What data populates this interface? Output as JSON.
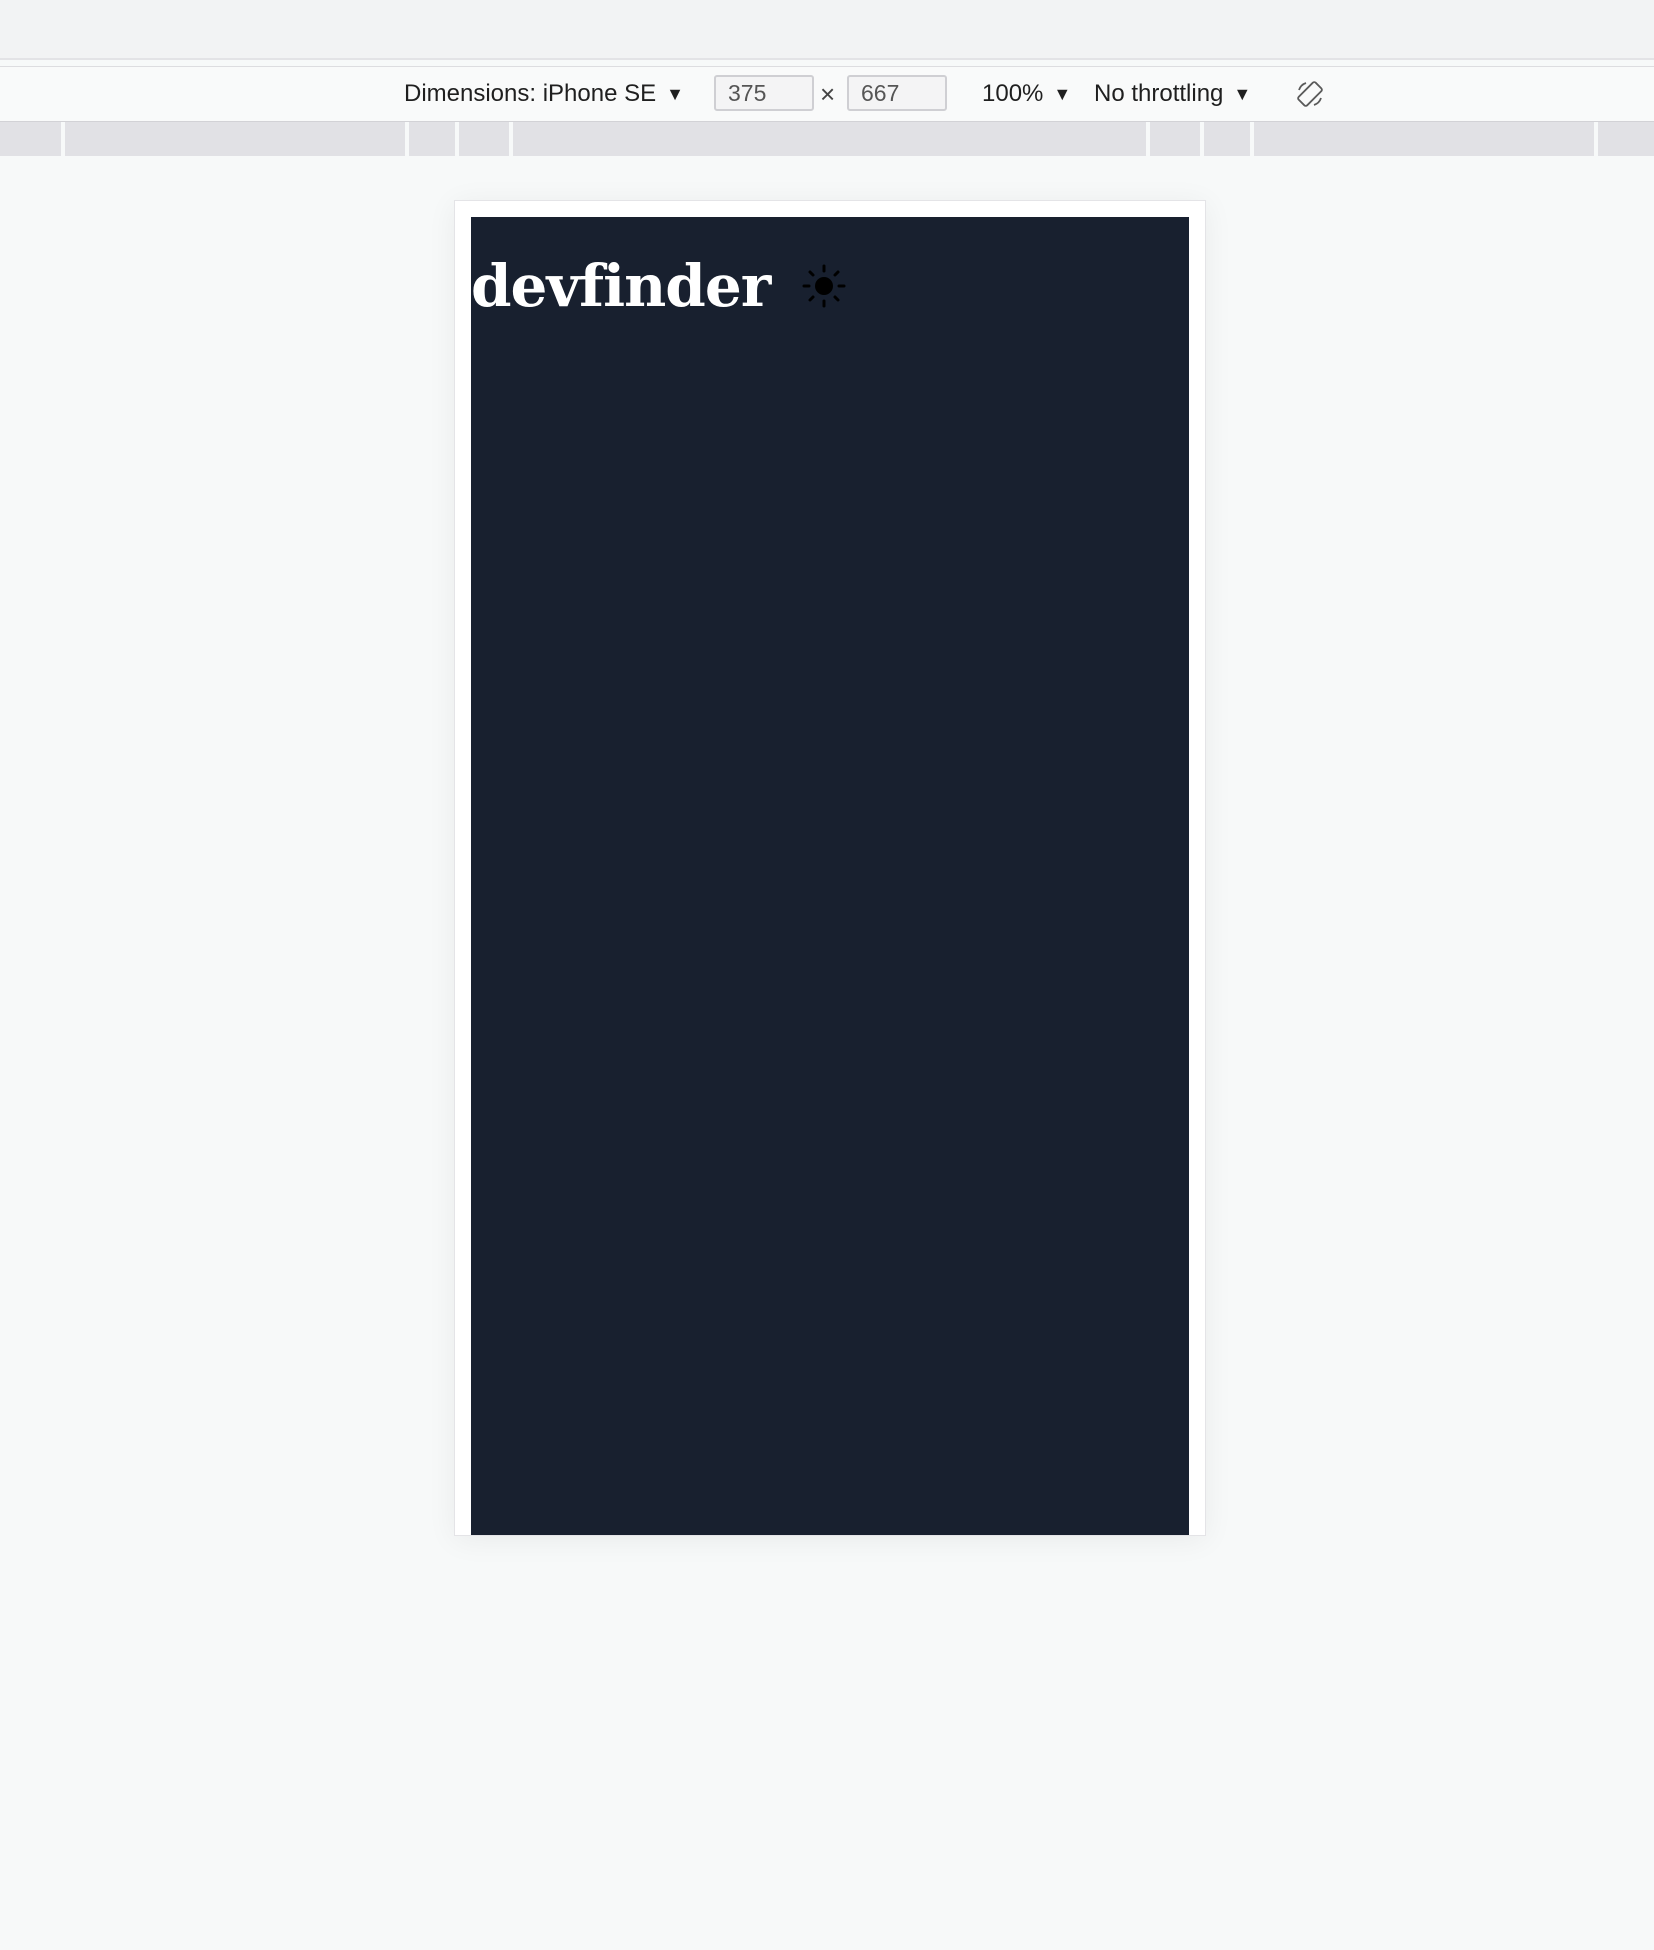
{
  "toolbar": {
    "dimensions_label": "Dimensions: iPhone SE",
    "width_value": "375",
    "height_value": "667",
    "times_glyph": "×",
    "zoom_label": "100%",
    "throttling_label": "No throttling",
    "caret_glyph": "▼"
  },
  "app": {
    "title": "devfinder",
    "background_color": "#18202f",
    "title_color": "#ffffff",
    "theme_icon": "sun-icon"
  }
}
